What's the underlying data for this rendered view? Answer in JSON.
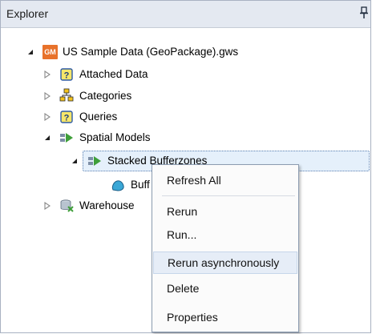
{
  "panel": {
    "title": "Explorer"
  },
  "tree": {
    "root": "US Sample Data (GeoPackage).gws",
    "root_badge": "GM",
    "items": [
      {
        "label": "Attached Data"
      },
      {
        "label": "Categories"
      },
      {
        "label": "Queries"
      },
      {
        "label": "Spatial Models"
      },
      {
        "label": "Stacked Bufferzones"
      },
      {
        "label": "Buff"
      },
      {
        "label": "Warehouse"
      }
    ]
  },
  "context_menu": {
    "items": [
      {
        "label": "Refresh All"
      },
      {
        "label": "Rerun"
      },
      {
        "label": "Run..."
      },
      {
        "label": "Rerun asynchronously"
      },
      {
        "label": "Delete"
      },
      {
        "label": "Properties"
      }
    ]
  }
}
